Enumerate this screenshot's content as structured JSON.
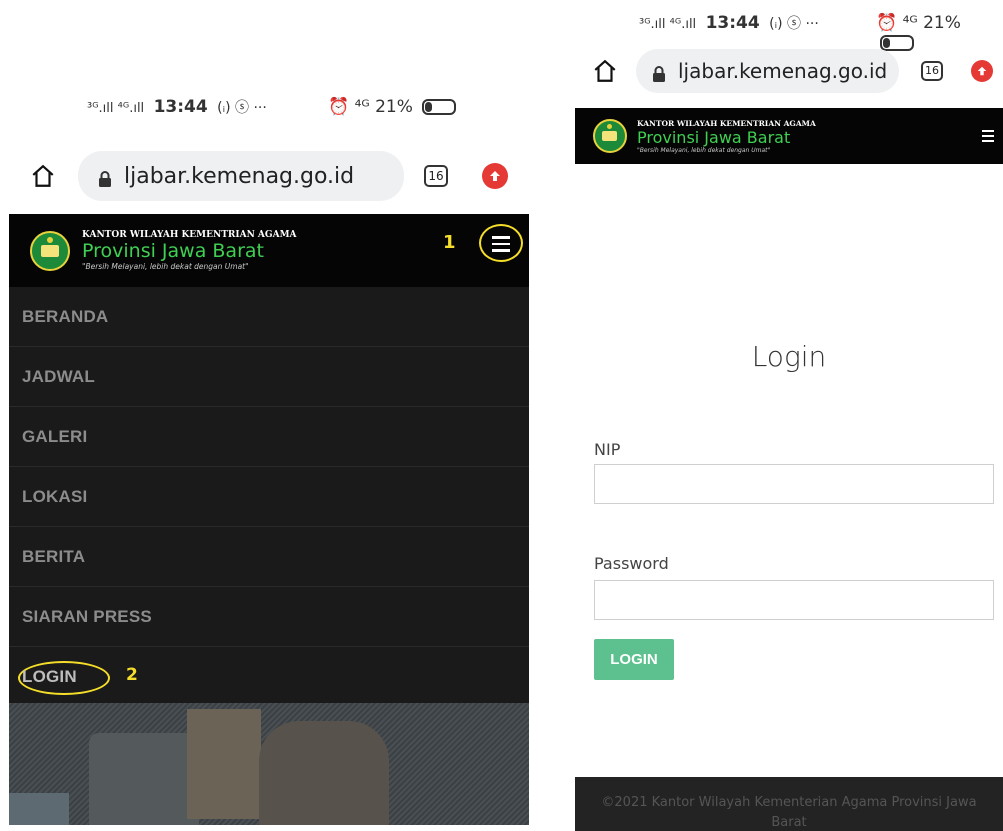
{
  "left_phone": {
    "status": {
      "network": "³ᴳ.ıll ⁴ᴳ.ıll",
      "time": "13:44",
      "icons_extra": "(ᵢ) ⓢ ···",
      "battery_text": "⏰ ⁴ᴳ 21%"
    },
    "address_bar": {
      "url": "ljabar.kemenag.go.id",
      "tab_count": "16"
    },
    "header": {
      "small_title": "KANTOR WILAYAH KEMENTRIAN AGAMA",
      "big_title": "Provinsi Jawa Barat",
      "tagline": "\"Bersih Melayani, lebih dekat dengan Umat\"",
      "annotation_number": "1"
    },
    "menu": {
      "items": [
        {
          "label": "BERANDA"
        },
        {
          "label": "JADWAL"
        },
        {
          "label": "GALERI"
        },
        {
          "label": "LOKASI"
        },
        {
          "label": "BERITA"
        },
        {
          "label": "SIARAN PRESS"
        },
        {
          "label": "LOGIN"
        }
      ],
      "annotation_number": "2"
    }
  },
  "right_phone": {
    "status": {
      "network": "³ᴳ.ıll ⁴ᴳ.ıll",
      "time": "13:44",
      "icons_extra": "(ᵢ) ⓢ ···",
      "battery_text": "⏰ ⁴ᴳ 21%"
    },
    "address_bar": {
      "url": "ljabar.kemenag.go.id",
      "tab_count": "16"
    },
    "header": {
      "small_title": "KANTOR WILAYAH KEMENTRIAN AGAMA",
      "big_title": "Provinsi Jawa Barat",
      "tagline": "\"Bersih Melayani, lebih dekat dengan Umat\""
    },
    "login": {
      "heading": "Login",
      "nip_label": "NIP",
      "nip_value": "",
      "password_label": "Password",
      "password_value": "",
      "button_label": "LOGIN"
    },
    "footer": "©2021 Kantor Wilayah Kementerian Agama Provinsi Jawa Barat"
  },
  "colors": {
    "header_bg": "#050505",
    "brand_green": "#3fcf52",
    "annotation_yellow": "#f5de2a",
    "login_button": "#5cc18e",
    "update_red": "#e53935"
  },
  "icons": [
    "home-icon",
    "lock-icon",
    "tabs-icon",
    "update-icon",
    "logo-icon",
    "hamburger-menu-icon"
  ]
}
